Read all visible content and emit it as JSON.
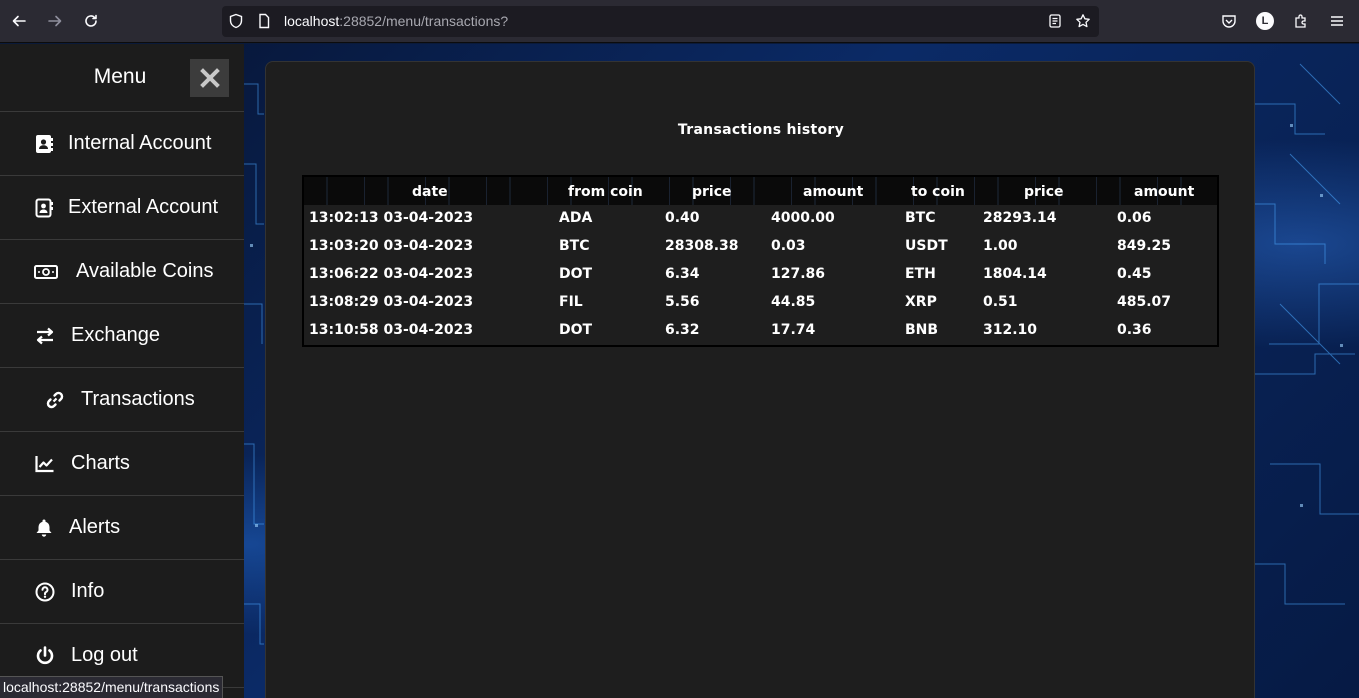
{
  "browser": {
    "url_host": "localhost",
    "url_rest": ":28852/menu/transactions?",
    "avatar_letter": "L",
    "status_url": "localhost:28852/menu/transactions"
  },
  "sidebar": {
    "title": "Menu",
    "items": [
      {
        "label": "Internal Account",
        "icon": "address-book-icon"
      },
      {
        "label": "External Account",
        "icon": "contact-card-icon"
      },
      {
        "label": "Available Coins",
        "icon": "money-bill-icon"
      },
      {
        "label": "Exchange",
        "icon": "exchange-arrows-icon"
      },
      {
        "label": "Transactions",
        "icon": "link-icon"
      },
      {
        "label": "Charts",
        "icon": "line-chart-icon"
      },
      {
        "label": "Alerts",
        "icon": "bell-icon"
      },
      {
        "label": "Info",
        "icon": "question-circle-icon"
      },
      {
        "label": "Log out",
        "icon": "power-icon"
      }
    ]
  },
  "main": {
    "title": "Transactions history",
    "columns": [
      "date",
      "from coin",
      "price",
      "amount",
      "to coin",
      "price",
      "amount"
    ],
    "rows": [
      [
        "13:02:13 03-04-2023",
        "ADA",
        "0.40",
        "4000.00",
        "BTC",
        "28293.14",
        "0.06"
      ],
      [
        "13:03:20 03-04-2023",
        "BTC",
        "28308.38",
        "0.03",
        "USDT",
        "1.00",
        "849.25"
      ],
      [
        "13:06:22 03-04-2023",
        "DOT",
        "6.34",
        "127.86",
        "ETH",
        "1804.14",
        "0.45"
      ],
      [
        "13:08:29 03-04-2023",
        "FIL",
        "5.56",
        "44.85",
        "XRP",
        "0.51",
        "485.07"
      ],
      [
        "13:10:58 03-04-2023",
        "DOT",
        "6.32",
        "17.74",
        "BNB",
        "312.10",
        "0.36"
      ]
    ]
  },
  "colors": {
    "sidebar_bg": "#1c1c1c",
    "panel_bg": "#1e1e1e",
    "chrome_bg": "#2b2a33",
    "text": "#ffffff"
  }
}
